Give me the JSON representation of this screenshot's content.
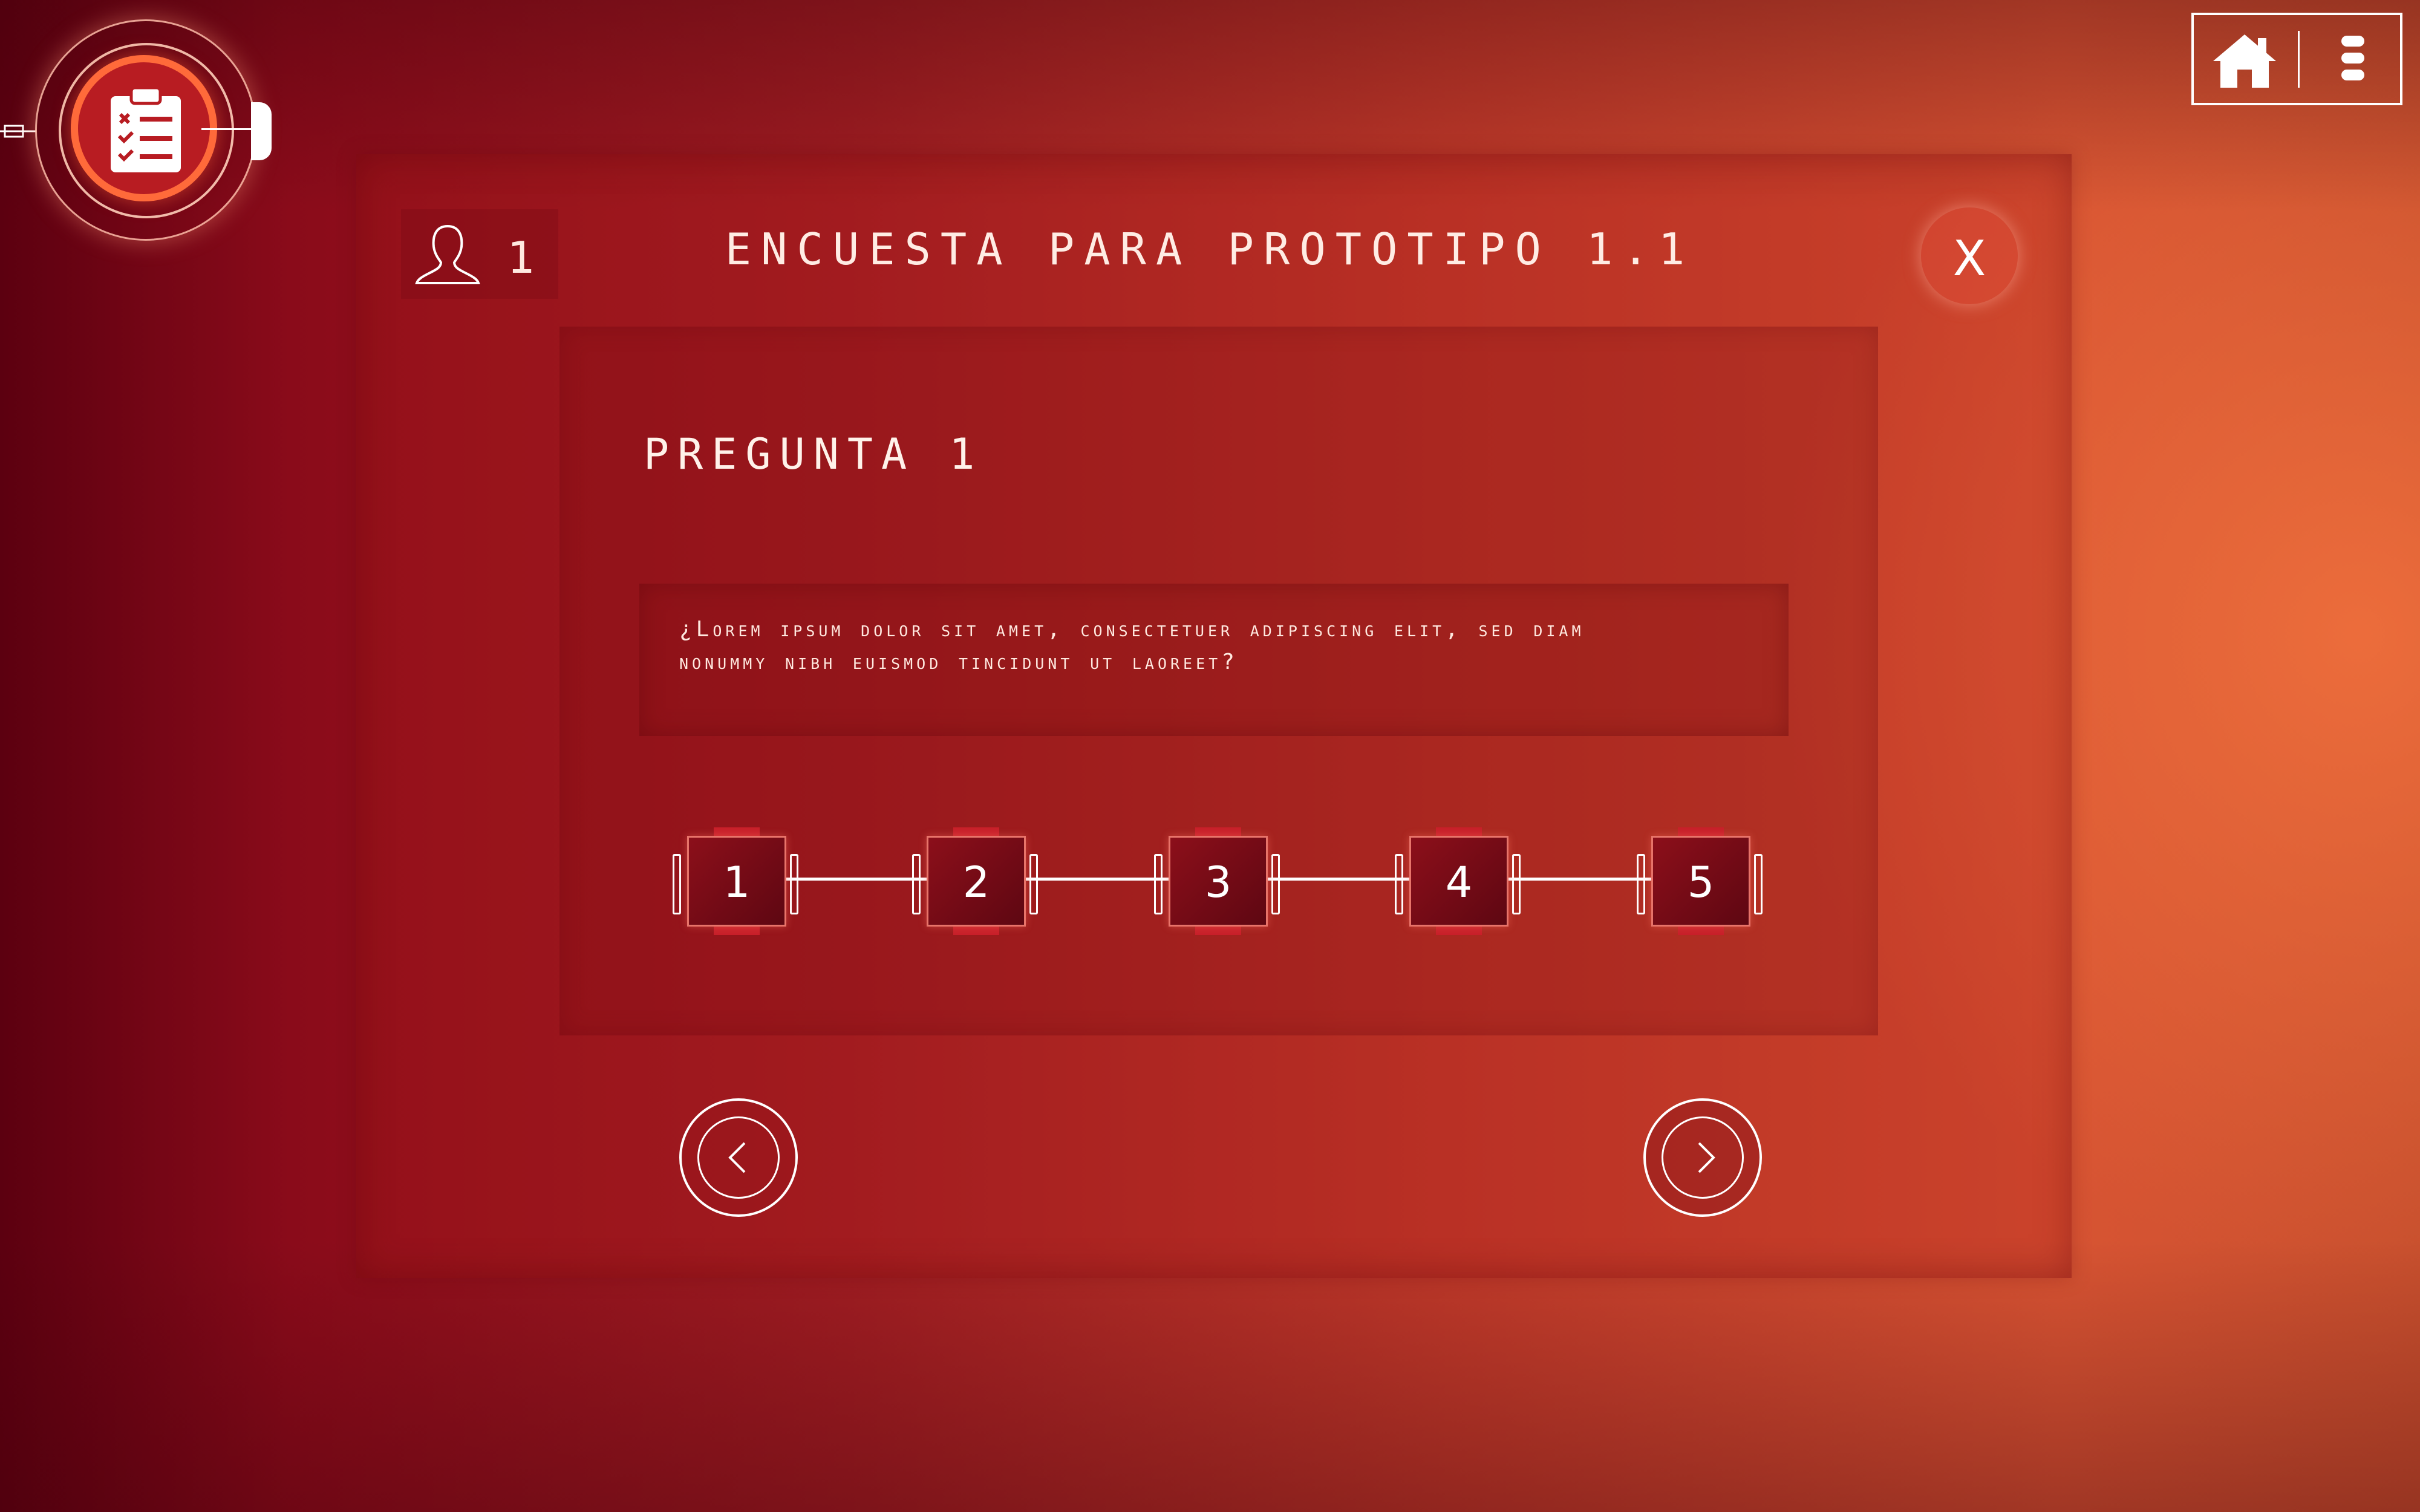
{
  "app": {
    "accent_color": "#ff6a3a",
    "badge_icon": "clipboard-checklist-icon"
  },
  "topnav": {
    "home_icon": "home-icon",
    "menu_icon": "menu-dots-icon"
  },
  "dialog": {
    "participants": "1",
    "title": "ENCUESTA PARA PROTOTIPO 1.1",
    "close_label": "X"
  },
  "question": {
    "label": "PREGUNTA 1",
    "text_line1": "¿Lorem ipsum dolor sit amet, consectetuer adipiscing elit, sed diam",
    "text_line2": "nonummy nibh euismod tincidunt ut laoreet?"
  },
  "scale": {
    "options": [
      "1",
      "2",
      "3",
      "4",
      "5"
    ]
  },
  "navigation": {
    "prev_icon": "chevron-left-icon",
    "next_icon": "chevron-right-icon"
  }
}
